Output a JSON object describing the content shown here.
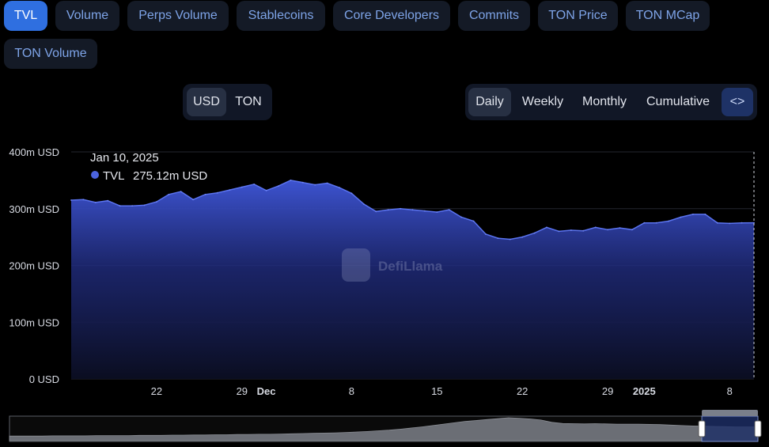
{
  "tabs": [
    {
      "label": "TVL",
      "active": true
    },
    {
      "label": "Volume"
    },
    {
      "label": "Perps Volume"
    },
    {
      "label": "Stablecoins"
    },
    {
      "label": "Core Developers"
    },
    {
      "label": "Commits"
    },
    {
      "label": "TON Price"
    },
    {
      "label": "TON MCap"
    },
    {
      "label": "TON Volume"
    }
  ],
  "denomination": {
    "options": [
      "USD",
      "TON"
    ],
    "selected": "USD"
  },
  "groupings": {
    "options": [
      "Daily",
      "Weekly",
      "Monthly",
      "Cumulative"
    ],
    "selected": "Daily",
    "embed_icon": "code-brackets-icon",
    "embed_glyph": "<>"
  },
  "tooltip": {
    "date": "Jan 10, 2025",
    "series": "TVL",
    "value": "275.12m USD"
  },
  "watermark": "DefiLlama",
  "colors": {
    "accent": "#2f6fe0",
    "series": "#4b63df",
    "background": "#000000"
  },
  "chart_data": {
    "type": "area",
    "series": [
      {
        "name": "TVL",
        "x": [
          "2024-11-15",
          "2024-11-16",
          "2024-11-17",
          "2024-11-18",
          "2024-11-19",
          "2024-11-20",
          "2024-11-21",
          "2024-11-22",
          "2024-11-23",
          "2024-11-24",
          "2024-11-25",
          "2024-11-26",
          "2024-11-27",
          "2024-11-28",
          "2024-11-29",
          "2024-11-30",
          "2024-12-01",
          "2024-12-02",
          "2024-12-03",
          "2024-12-04",
          "2024-12-05",
          "2024-12-06",
          "2024-12-07",
          "2024-12-08",
          "2024-12-09",
          "2024-12-10",
          "2024-12-11",
          "2024-12-12",
          "2024-12-13",
          "2024-12-14",
          "2024-12-15",
          "2024-12-16",
          "2024-12-17",
          "2024-12-18",
          "2024-12-19",
          "2024-12-20",
          "2024-12-21",
          "2024-12-22",
          "2024-12-23",
          "2024-12-24",
          "2024-12-25",
          "2024-12-26",
          "2024-12-27",
          "2024-12-28",
          "2024-12-29",
          "2024-12-30",
          "2024-12-31",
          "2025-01-01",
          "2025-01-02",
          "2025-01-03",
          "2025-01-04",
          "2025-01-05",
          "2025-01-06",
          "2025-01-07",
          "2025-01-08",
          "2025-01-09",
          "2025-01-10"
        ],
        "values": [
          315,
          316,
          311,
          314,
          305,
          305,
          306,
          312,
          325,
          330,
          316,
          325,
          328,
          333,
          338,
          343,
          332,
          340,
          350,
          346,
          342,
          345,
          337,
          327,
          308,
          295,
          298,
          300,
          298,
          296,
          294,
          298,
          285,
          278,
          255,
          248,
          246,
          250,
          257,
          267,
          260,
          262,
          261,
          267,
          263,
          266,
          263,
          275,
          275,
          278,
          285,
          290,
          290,
          275,
          274,
          275,
          275.12
        ]
      }
    ],
    "y_label_suffix": " USD",
    "y_ticks": [
      "0 USD",
      "100m USD",
      "200m USD",
      "300m USD",
      "400m USD"
    ],
    "ylim": [
      0,
      400
    ],
    "x_ticks": [
      {
        "label": "22",
        "date": "2024-11-22",
        "bold": false
      },
      {
        "label": "29",
        "date": "2024-11-29",
        "bold": false
      },
      {
        "label": "Dec",
        "date": "2024-12-01",
        "bold": true
      },
      {
        "label": "8",
        "date": "2024-12-08",
        "bold": false
      },
      {
        "label": "15",
        "date": "2024-12-15",
        "bold": false
      },
      {
        "label": "22",
        "date": "2024-12-22",
        "bold": false
      },
      {
        "label": "29",
        "date": "2024-12-29",
        "bold": false
      },
      {
        "label": "2025",
        "date": "2025-01-01",
        "bold": true
      },
      {
        "label": "8",
        "date": "2025-01-08",
        "bold": false
      }
    ],
    "grid": true,
    "hovered_date": "2025-01-10"
  },
  "navigator": {
    "profile": [
      20,
      20,
      20,
      20,
      21,
      21,
      21,
      21,
      22,
      22,
      22,
      22,
      23,
      23,
      23,
      24,
      24,
      25,
      25,
      26,
      26,
      27,
      27,
      28,
      28,
      29,
      30,
      31,
      32,
      33,
      34,
      36,
      38,
      40,
      43,
      46,
      50,
      55,
      60,
      66,
      72,
      78,
      84,
      88,
      92,
      96,
      100,
      98,
      95,
      90,
      80,
      75,
      74,
      73,
      74,
      73,
      72,
      72,
      72,
      71,
      70,
      68,
      66,
      64,
      63,
      62,
      61,
      60,
      60,
      60
    ],
    "selection_start": 0.925,
    "selection_end": 1.0
  }
}
